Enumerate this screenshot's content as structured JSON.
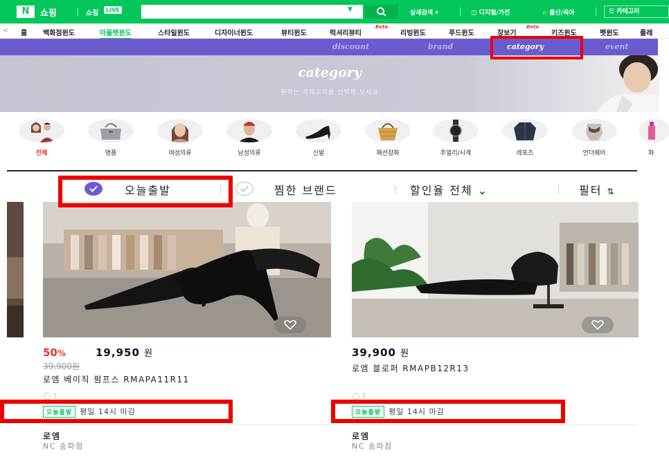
{
  "header": {
    "logo_mark": "N",
    "logo_text": "쇼핑",
    "live_label": "쇼핑",
    "live_badge": "LIVE",
    "search_value": "",
    "detail_search": "상세검색",
    "menu_digital": "디지털/가전",
    "menu_baby": "출산/육아",
    "category_all": "카테고리 "
  },
  "window_nav": {
    "prev_arrow": "<",
    "items": [
      {
        "label": "홈"
      },
      {
        "label": "백화점윈도"
      },
      {
        "label": "아울렛윈도"
      },
      {
        "label": "스타일윈도"
      },
      {
        "label": "디자이너윈도"
      },
      {
        "label": "뷰티윈도"
      },
      {
        "label": "럭셔리뷰티",
        "badge": "Beta"
      },
      {
        "label": "리빙윈도"
      },
      {
        "label": "푸드윈도"
      },
      {
        "label": "장보기",
        "badge": "Beta"
      },
      {
        "label": "키즈윈도"
      },
      {
        "label": "펫윈도"
      },
      {
        "label": "플레"
      }
    ],
    "active_index": 2
  },
  "sub_nav": {
    "items": [
      {
        "label": "discount"
      },
      {
        "label": "brand"
      },
      {
        "label": "category"
      },
      {
        "label": "event"
      }
    ],
    "active_index": 2
  },
  "banner": {
    "title": "category",
    "subtitle": "원하는 카테고리를 선택해 보세요"
  },
  "categories": {
    "items": [
      {
        "label": "전체",
        "icon": "couple-icon"
      },
      {
        "label": "명품",
        "icon": "handbag-icon"
      },
      {
        "label": "여성의류",
        "icon": "woman-icon"
      },
      {
        "label": "남성의류",
        "icon": "man-icon"
      },
      {
        "label": "신발",
        "icon": "heel-shoe-icon"
      },
      {
        "label": "패션잡화",
        "icon": "basket-bag-icon"
      },
      {
        "label": "주얼리/시계",
        "icon": "watch-icon"
      },
      {
        "label": "레포츠",
        "icon": "jacket-icon"
      },
      {
        "label": "언더웨어",
        "icon": "underwear-icon"
      },
      {
        "label": "화",
        "icon": "cosmetics-icon"
      }
    ],
    "active_index": 0
  },
  "filters": {
    "today_ship": "오늘출발",
    "liked_brand": "찜한 브랜드",
    "discount_all": "할인율 전체",
    "filter": "필터"
  },
  "products": [
    {
      "discount": "50",
      "discount_unit": "%",
      "price": "19,950",
      "currency": "원",
      "original_price": "39,900원",
      "name": "로엠 베이직 펌프스 RMAPA11R11",
      "review_count": "1",
      "ship_badge": "오늘출발",
      "ship_text": "평일 14시 마감",
      "brand": "로엠",
      "store": "NC 송파점"
    },
    {
      "price": "39,900",
      "currency": "원",
      "name": "로엠 블로퍼 RMAPB12R13",
      "review_count": "1",
      "ship_badge": "오늘출발",
      "ship_text": "평일 14시 마감",
      "brand": "로엠",
      "store": "NC 송파점"
    }
  ],
  "colors": {
    "naver_green": "#03c75a",
    "purple_nav": "#6a5ccf",
    "discount_red": "#e8332a",
    "highlight_red": "#ee0000"
  }
}
